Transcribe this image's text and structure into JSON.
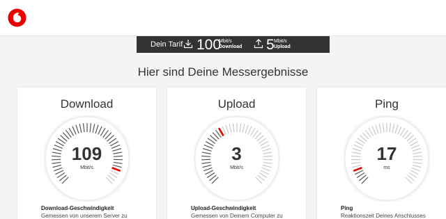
{
  "header": {
    "logo_icon": "vodafone-logo-icon",
    "brand_color": "#e60000"
  },
  "tariff": {
    "label": "Dein Tarif",
    "download_value": "100",
    "download_unit": "Mbit/s",
    "download_label": "Download",
    "upload_value": "5",
    "upload_unit": "Mbit/s",
    "upload_label": "Upload"
  },
  "results_title": "Hier sind Deine Messergebnisse",
  "cards": [
    {
      "title": "Download",
      "value": "109",
      "unit": "Mbit/s",
      "detail_title": "Download-Geschwindigkeit",
      "detail_text": "Gemessen von unserem Server zu",
      "gauge_fraction": 0.92
    },
    {
      "title": "Upload",
      "value": "3",
      "unit": "Mbit/s",
      "detail_title": "Upload-Geschwindigkeit",
      "detail_text": "Gemessen von Deinem Computer zu",
      "gauge_fraction": 0.38
    },
    {
      "title": "Ping",
      "value": "17",
      "unit": "ms",
      "detail_title": "Ping",
      "detail_text": "Reaktionszeit Deines Anschlusses",
      "gauge_fraction": 0.08
    }
  ]
}
